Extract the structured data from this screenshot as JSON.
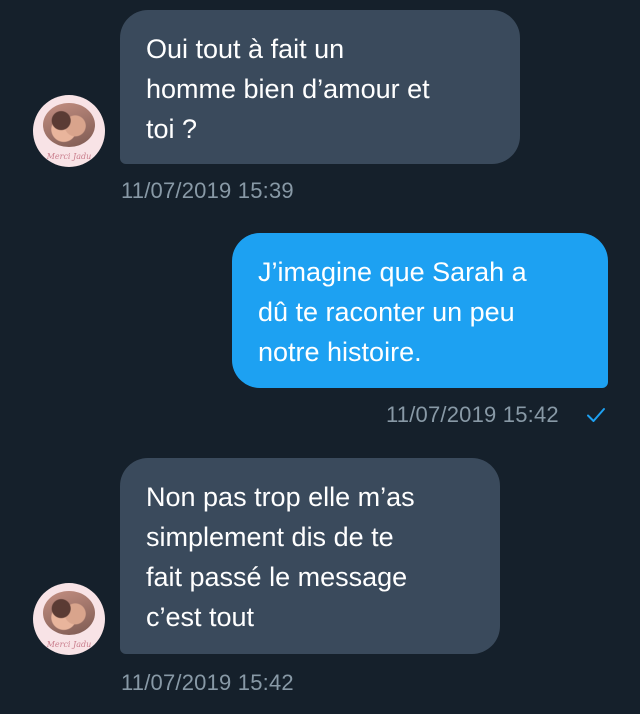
{
  "messages": [
    {
      "direction": "incoming",
      "text": "Oui tout à fait un\nhomme bien d’amour et\ntoi ?",
      "timestamp": "11/07/2019 15:39",
      "avatar_caption": "Merci Jadu"
    },
    {
      "direction": "outgoing",
      "text": "J’imagine que Sarah a\ndû te raconter un peu\nnotre histoire.",
      "timestamp": "11/07/2019 15:42",
      "status_icon": "checkmark-icon"
    },
    {
      "direction": "incoming",
      "text": "Non pas trop elle m’as\nsimplement dis de te\nfait passé le message\nc’est tout",
      "timestamp": "11/07/2019 15:42",
      "avatar_caption": "Merci Jadu"
    }
  ],
  "colors": {
    "background": "#15202b",
    "incoming_bubble": "#3a4a5c",
    "outgoing_bubble": "#1da1f2",
    "timestamp": "#8899a6",
    "read_check": "#1da1f2"
  }
}
